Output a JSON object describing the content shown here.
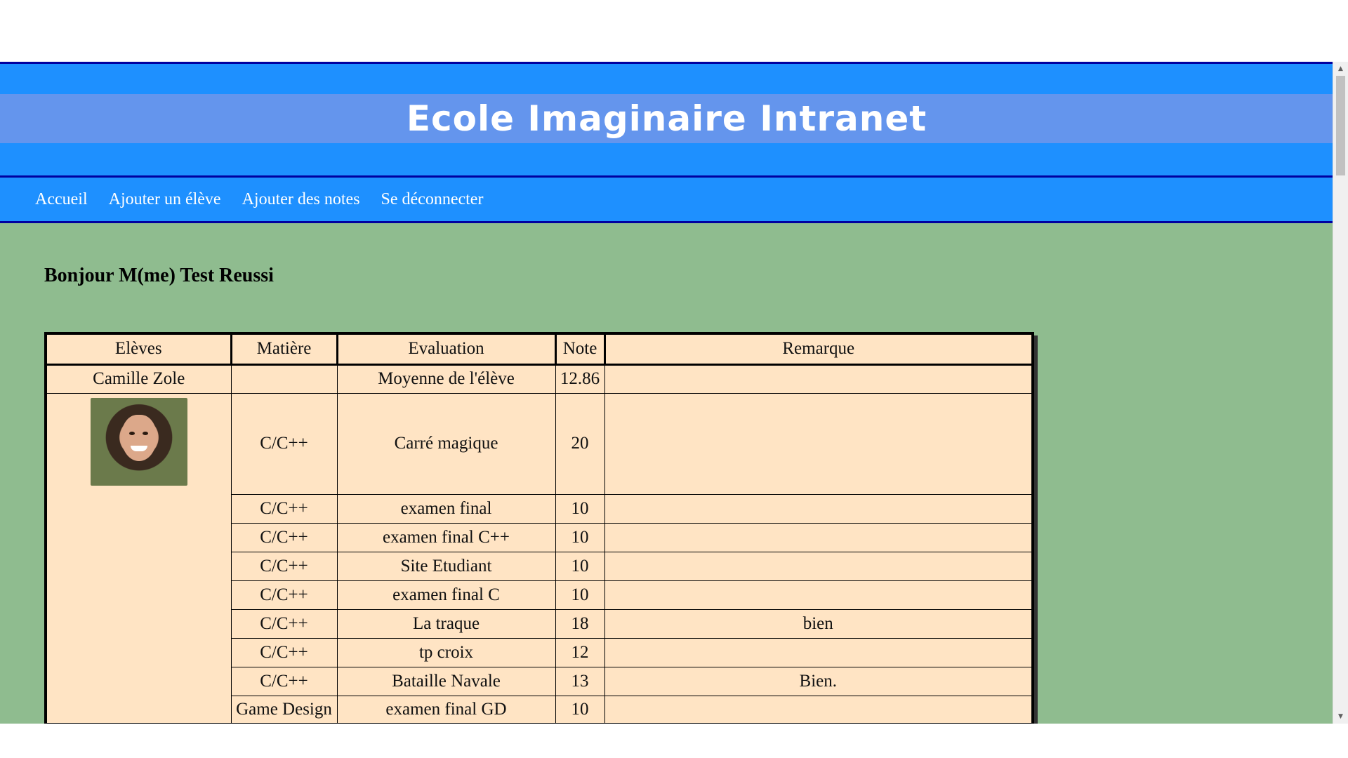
{
  "header": {
    "title": "Ecole Imaginaire Intranet"
  },
  "nav": {
    "items": [
      {
        "label": "Accueil"
      },
      {
        "label": "Ajouter un élève"
      },
      {
        "label": "Ajouter des notes"
      },
      {
        "label": "Se déconnecter"
      }
    ]
  },
  "greeting": "Bonjour M(me) Test Reussi",
  "table": {
    "headers": [
      "Elèves",
      "Matière",
      "Evaluation",
      "Note",
      "Remarque"
    ],
    "student": {
      "name": "Camille Zole",
      "average_label": "Moyenne de l'élève",
      "average": "12.86"
    },
    "rows": [
      {
        "subject": "C/C++",
        "evaluation": "Carré magique",
        "note": "20",
        "remark": ""
      },
      {
        "subject": "C/C++",
        "evaluation": "examen final",
        "note": "10",
        "remark": ""
      },
      {
        "subject": "C/C++",
        "evaluation": "examen final C++",
        "note": "10",
        "remark": ""
      },
      {
        "subject": "C/C++",
        "evaluation": "Site Etudiant",
        "note": "10",
        "remark": ""
      },
      {
        "subject": "C/C++",
        "evaluation": "examen final C",
        "note": "10",
        "remark": ""
      },
      {
        "subject": "C/C++",
        "evaluation": "La traque",
        "note": "18",
        "remark": "bien"
      },
      {
        "subject": "C/C++",
        "evaluation": "tp croix",
        "note": "12",
        "remark": ""
      },
      {
        "subject": "C/C++",
        "evaluation": "Bataille Navale",
        "note": "13",
        "remark": "Bien."
      },
      {
        "subject": "Game Design",
        "evaluation": "examen final GD",
        "note": "10",
        "remark": ""
      }
    ]
  },
  "colors": {
    "header": "#1e90ff",
    "title_strip": "#6495ed",
    "page_background": "#8fbc8f",
    "table_background": "#ffe4c4"
  }
}
